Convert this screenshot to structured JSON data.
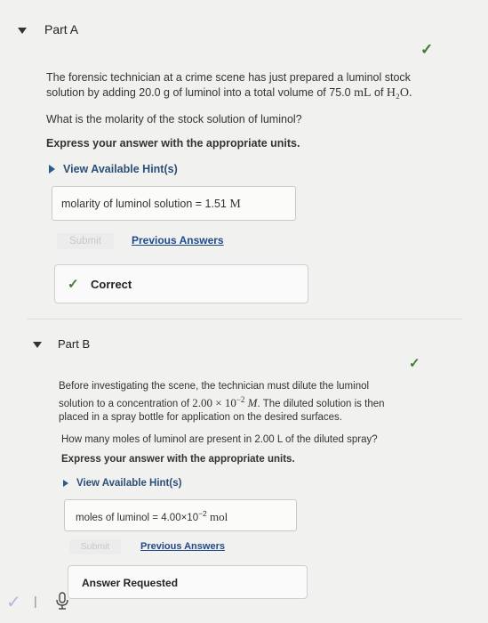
{
  "partA": {
    "title": "Part A",
    "question_line1": "The forensic technician at a crime scene has just prepared a luminol stock",
    "question_line2_pre": "solution by adding 20.0 g of luminol into a total volume of 75.0 ",
    "question_unit": "mL",
    "question_of": " of ",
    "question_formula": "H₂O.",
    "ask": "What is the molarity of the stock solution of luminol?",
    "instruction": "Express your answer with the appropriate units.",
    "hint_label": "View Available Hint(s)",
    "answer_label": "molarity of luminol solution = ",
    "answer_value": "1.51",
    "answer_unit": " M",
    "submit_label": "Submit",
    "previous_answers_label": "Previous Answers",
    "feedback": "Correct",
    "check_glyph": "✓"
  },
  "partB": {
    "title": "Part B",
    "question_line1": "Before investigating the scene, the technician must dilute the luminol",
    "question_line2_pre": "solution to a concentration of ",
    "question_conc": "2.00 × 10",
    "question_exp": "−2",
    "question_unit": " M",
    "question_line2_post": ". The diluted solution is then",
    "question_line3": "placed in a spray bottle for application on the desired surfaces.",
    "ask": "How many moles of luminol are present in 2.00 L of the diluted spray?",
    "instruction": "Express your answer with the appropriate units.",
    "hint_label": "View Available Hint(s)",
    "answer_label": "moles of luminol = ",
    "answer_value": "4.00×10",
    "answer_exp": "−2",
    "answer_unit": " mol",
    "submit_label": "Submit",
    "previous_answers_label": "Previous Answers",
    "feedback": "Answer Requested",
    "check_glyph": "✓"
  },
  "footer": {
    "check_glyph": "✓",
    "separator": "|"
  }
}
